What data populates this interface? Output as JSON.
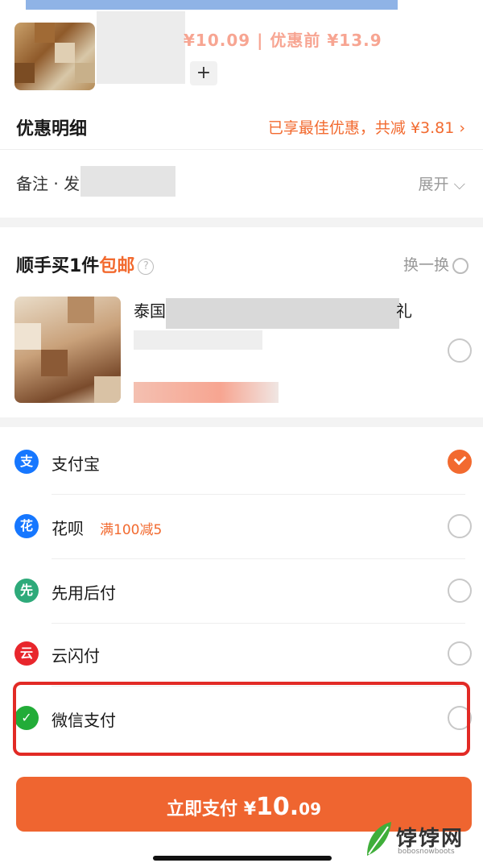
{
  "product": {
    "price_text": "¥10.09 | 优惠前 ¥13.9",
    "add_label": "+"
  },
  "discount": {
    "label": "优惠明细",
    "summary": "已享最佳优惠，共减 ¥3.81 ›"
  },
  "note": {
    "label": "备注 · 发",
    "expand_label": "展开 ⌵"
  },
  "addon": {
    "heading_prefix": "顺手买1件",
    "heading_highlight": "包邮",
    "help_icon": "question-circle-icon",
    "swap_label": "换一换",
    "item_title_start": "泰国鱼",
    "item_title_end": "礼"
  },
  "payment_methods": [
    {
      "name": "支付宝",
      "promo": "",
      "icon": "alipay-icon",
      "icon_color": "#1677ff",
      "icon_glyph": "支",
      "selected": true
    },
    {
      "name": "花呗",
      "promo": "满100减5",
      "icon": "huabei-icon",
      "icon_color": "#1677ff",
      "icon_glyph": "花",
      "selected": false
    },
    {
      "name": "先用后付",
      "promo": "",
      "icon": "pay-later-icon",
      "icon_color": "#2eaa7a",
      "icon_glyph": "先",
      "selected": false
    },
    {
      "name": "云闪付",
      "promo": "",
      "icon": "unionpay-icon",
      "icon_color": "#e8262c",
      "icon_glyph": "云",
      "selected": false
    },
    {
      "name": "微信支付",
      "promo": "",
      "icon": "wechat-pay-icon",
      "icon_color": "#22ac38",
      "icon_glyph": "✓",
      "selected": false
    }
  ],
  "pay_button": {
    "label": "立即支付",
    "currency": "¥",
    "amount_whole": "10.",
    "amount_cents": "09"
  },
  "watermark": {
    "brand": "饽饽网",
    "url": "bobosnowboots"
  },
  "colors": {
    "accent": "#ef6530",
    "highlight_border": "#e22a25"
  }
}
